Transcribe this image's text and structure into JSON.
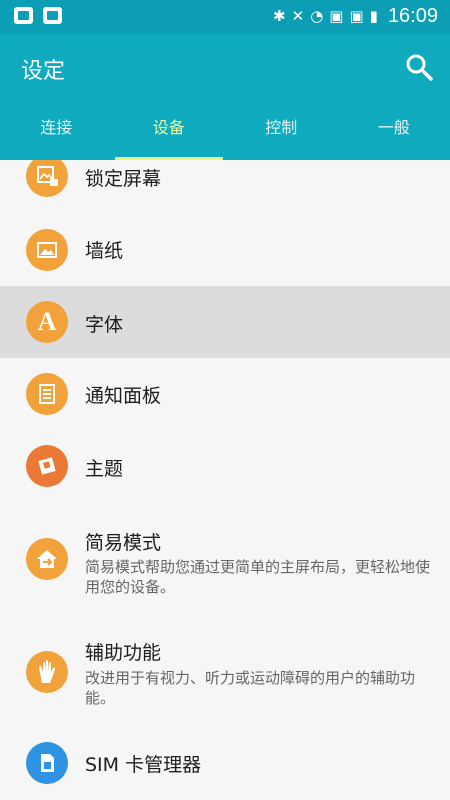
{
  "status": {
    "time": "16:09",
    "icons": [
      "upload-box-icon",
      "search-box-icon",
      "bluetooth-icon",
      "mute-icon",
      "wifi-icon",
      "sim1-icon",
      "sim2-icon",
      "battery-icon"
    ]
  },
  "header": {
    "title": "设定",
    "search_icon": "search-icon",
    "tabs": [
      {
        "label": "连接",
        "active": false
      },
      {
        "label": "设备",
        "active": true
      },
      {
        "label": "控制",
        "active": false
      },
      {
        "label": "一般",
        "active": false
      }
    ]
  },
  "items": [
    {
      "label": "锁定屏幕",
      "icon": "lock-screen-icon"
    },
    {
      "label": "墙纸",
      "icon": "wallpaper-icon"
    },
    {
      "label": "字体",
      "icon": "font-icon",
      "selected": true
    },
    {
      "label": "通知面板",
      "icon": "notification-panel-icon"
    },
    {
      "label": "主题",
      "icon": "theme-icon"
    },
    {
      "label": "简易模式",
      "desc": "简易模式帮助您通过更简单的主屏布局，更轻松地使用您的设备。",
      "icon": "easy-mode-icon"
    },
    {
      "label": "辅助功能",
      "desc": "改进用于有视力、听力或运动障碍的用户的辅助功能。",
      "icon": "accessibility-icon"
    },
    {
      "label": "SIM 卡管理器",
      "icon": "sim-manager-icon"
    }
  ],
  "colors": {
    "status_bar": "#0c9eb5",
    "app_bar": "#0faabd",
    "tab_indicator": "#e6f57c",
    "icon_orange": "#f1a23b",
    "icon_deep_orange": "#e97935",
    "icon_blue": "#2e93e0"
  }
}
